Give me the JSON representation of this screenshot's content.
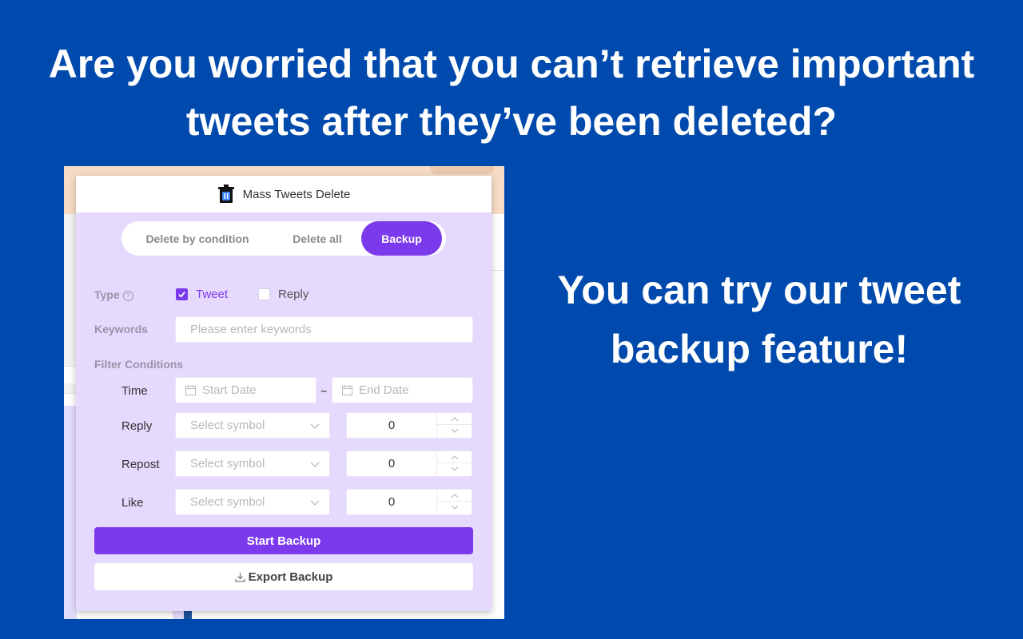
{
  "headline": {
    "line1": "Are you worried that you can’t retrieve important",
    "line2": "tweets after they’ve been deleted?"
  },
  "subline": {
    "line1": "You can try our tweet",
    "line2": "backup feature!"
  },
  "popup": {
    "title": "Mass Tweets Delete",
    "tabs": [
      {
        "label": "Delete by condition",
        "active": false
      },
      {
        "label": "Delete all",
        "active": false
      },
      {
        "label": "Backup",
        "active": true
      }
    ],
    "type_label": "Type",
    "type_options": [
      {
        "label": "Tweet",
        "checked": true
      },
      {
        "label": "Reply",
        "checked": false
      }
    ],
    "keywords_label": "Keywords",
    "keywords_placeholder": "Please enter keywords",
    "filter_label": "Filter Conditions",
    "time_label": "Time",
    "start_date_placeholder": "Start Date",
    "date_separator": "~",
    "end_date_placeholder": "End Date",
    "conditions": [
      {
        "label": "Reply",
        "symbol_placeholder": "Select symbol",
        "value": "0"
      },
      {
        "label": "Repost",
        "symbol_placeholder": "Select symbol",
        "value": "0"
      },
      {
        "label": "Like",
        "symbol_placeholder": "Select symbol",
        "value": "0"
      }
    ],
    "start_button": "Start Backup",
    "export_button": "Export Backup"
  },
  "colors": {
    "background": "#004aad",
    "accent": "#7c3aed",
    "panel": "#e5d9fd"
  },
  "icons": [
    "trash-icon",
    "help-icon",
    "check-icon",
    "calendar-icon",
    "chevron-down-icon",
    "chevron-up-icon",
    "download-icon"
  ]
}
